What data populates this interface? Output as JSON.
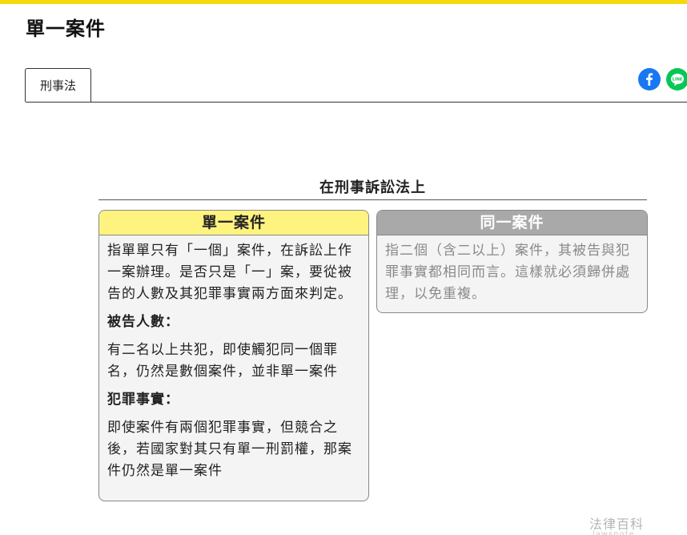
{
  "page": {
    "title": "單一案件",
    "accent_color": "#f5d80e"
  },
  "tabs": [
    {
      "label": "刑事法"
    }
  ],
  "share": {
    "facebook_icon": "facebook-icon",
    "line_icon": "line-icon",
    "line_text": "LINE"
  },
  "diagram": {
    "heading": "在刑事訴訟法上",
    "left_card": {
      "title": "單一案件",
      "header_color": "#fff37f",
      "intro": "指單單只有「一個」案件，在訴訟上作一案辦理。是否只是「一」案，要從被告的人數及其犯罪事實兩方面來判定。",
      "sections": [
        {
          "heading": "被告人數：",
          "text": "有二名以上共犯，即使觸犯同一個罪名，仍然是數個案件，並非單一案件"
        },
        {
          "heading": "犯罪事實：",
          "text": "即使案件有兩個犯罪事實，但競合之後，若國家對其只有單一刑罰權，那案件仍然是單一案件"
        }
      ]
    },
    "right_card": {
      "title": "同一案件",
      "header_color": "#a9a9a9",
      "text": "指二個（含二以上）案件，其被告與犯罪事實都相同而言。這樣就必須歸併處理，以免重複。"
    }
  },
  "watermark": {
    "text": "法律百科",
    "subtext": "lawsnote"
  }
}
